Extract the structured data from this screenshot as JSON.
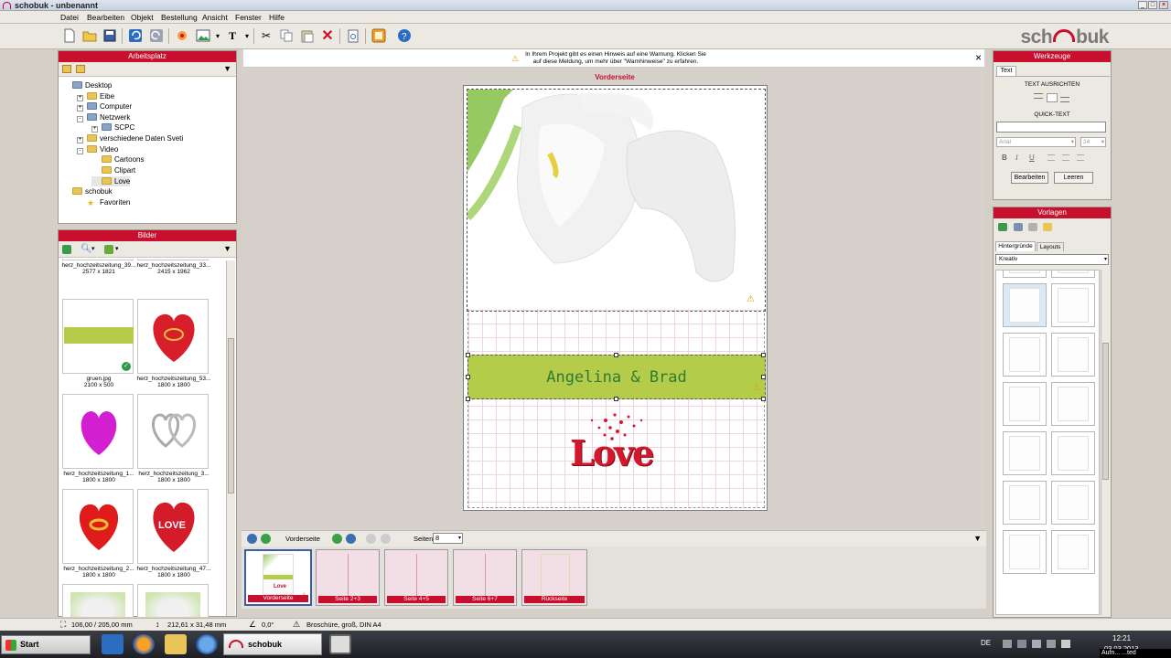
{
  "window": {
    "title": "schobuk - unbenannt",
    "min": "_",
    "max": "□",
    "close": "×"
  },
  "menu": [
    "Datei",
    "Bearbeiten",
    "Objekt",
    "Bestellung",
    "Ansicht",
    "Fenster",
    "Hilfe"
  ],
  "logo": {
    "left": "sch",
    "right": "buk"
  },
  "arbeitsplatz": {
    "title": "Arbeitsplatz",
    "tree": [
      {
        "label": "Desktop",
        "level": 0,
        "expander": "",
        "icon": "desktop-icon"
      },
      {
        "label": "Eibe",
        "level": 1,
        "expander": "+",
        "icon": "folder-icon"
      },
      {
        "label": "Computer",
        "level": 1,
        "expander": "+",
        "icon": "computer-icon"
      },
      {
        "label": "Netzwerk",
        "level": 1,
        "expander": "-",
        "icon": "network-icon"
      },
      {
        "label": "SCPC",
        "level": 2,
        "expander": "+",
        "icon": "computer-icon"
      },
      {
        "label": "verschiedene Daten Sveti",
        "level": 1,
        "expander": "+",
        "icon": "folder-icon"
      },
      {
        "label": "Video",
        "level": 1,
        "expander": "-",
        "icon": "folder-icon"
      },
      {
        "label": "Cartoons",
        "level": 2,
        "expander": "",
        "icon": "folder-icon"
      },
      {
        "label": "Clipart",
        "level": 2,
        "expander": "",
        "icon": "folder-icon"
      },
      {
        "label": "Love",
        "level": 2,
        "expander": "",
        "icon": "folder-icon",
        "selected": true
      },
      {
        "label": "schobuk",
        "level": 0,
        "expander": "",
        "icon": "folder-icon"
      },
      {
        "label": "Favoriten",
        "level": 1,
        "expander": "",
        "icon": "star-icon"
      }
    ]
  },
  "bilder": {
    "title": "Bilder",
    "images": [
      {
        "name": "herz_hochzeitszeitung_39...",
        "size": "2577 x 1821",
        "kind": "partial"
      },
      {
        "name": "herz_hochzeitszeitung_33...",
        "size": "2415 x 1962",
        "kind": "partial"
      },
      {
        "name": "gruen.jpg",
        "size": "2100 x 500",
        "kind": "green"
      },
      {
        "name": "herz_hochzeitszeitung_53...",
        "size": "1800 x 1800",
        "kind": "heart-gold"
      },
      {
        "name": "herz_hochzeitszeitung_1...",
        "size": "1800 x 1800",
        "kind": "heart-pink"
      },
      {
        "name": "herz_hochzeitszeitung_3...",
        "size": "1800 x 1800",
        "kind": "heart-silver"
      },
      {
        "name": "herz_hochzeitszeitung_2...",
        "size": "1800 x 1800",
        "kind": "heart-rings"
      },
      {
        "name": "herz_hochzeitszeitung_47...",
        "size": "1800 x 1800",
        "kind": "heart-love"
      }
    ]
  },
  "warning": {
    "line1": "In Ihrem Projekt gibt es einen Hinweis auf eine Warnung. Klicken Sie",
    "line2": "auf diese Meldung, um mehr über \"Warnhinweise\" zu erfahren.",
    "close": "×"
  },
  "canvas": {
    "page_label": "Vorderseite",
    "banner_text": "Angelina & Brad",
    "love_text": "Love"
  },
  "pagebar": {
    "current": "Vorderseite",
    "pages_label": "Seiten",
    "pages_value": "8"
  },
  "pages": [
    "Vorderseite",
    "Seite 2+3",
    "Seite 4+5",
    "Seite 6+7",
    "Rückseite"
  ],
  "werkzeuge": {
    "title": "Werkzeuge",
    "tab": "Text",
    "align_title": "TEXT AUSRICHTEN",
    "quick_title": "QUICK-TEXT",
    "font_value": "Arial",
    "size_value": "24",
    "bold": "B",
    "italic": "I",
    "underline": "U",
    "edit_btn": "Bearbeiten",
    "clear_btn": "Leeren"
  },
  "vorlagen": {
    "title": "Vorlagen",
    "tabs": [
      "Hintergründe",
      "Layouts"
    ],
    "category": "Kreativ"
  },
  "status": {
    "size": "106,00 / 205,00 mm",
    "pos": "212,61 x 31,48 mm",
    "angle": "0,0°",
    "product": "Broschüre, groß, DIN A4"
  },
  "taskbar": {
    "start": "Start",
    "app": "schobuk",
    "lang": "DE",
    "time": "12:21",
    "date": "03.03.2013",
    "overlay": "Aufn... ...ted"
  },
  "colors": {
    "brand_red": "#c8102e",
    "green_banner": "#b5cc4a",
    "banner_text": "#2f7a35"
  }
}
